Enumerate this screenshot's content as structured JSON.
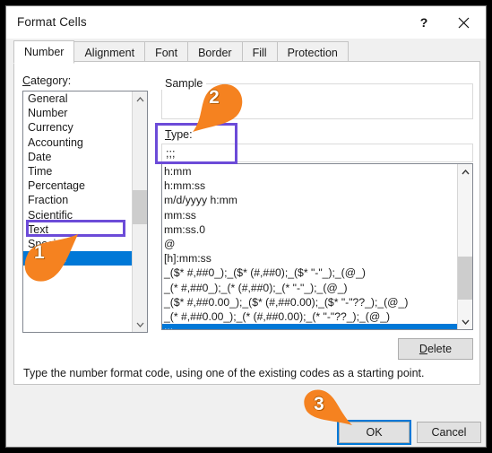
{
  "window": {
    "title": "Format Cells",
    "help_label": "?",
    "close_label": "✕"
  },
  "tabs": [
    {
      "label": "Number",
      "active": true
    },
    {
      "label": "Alignment",
      "active": false
    },
    {
      "label": "Font",
      "active": false
    },
    {
      "label": "Border",
      "active": false
    },
    {
      "label": "Fill",
      "active": false
    },
    {
      "label": "Protection",
      "active": false
    }
  ],
  "category": {
    "label": "Category:",
    "accelerator": "C",
    "items": [
      "General",
      "Number",
      "Currency",
      "Accounting",
      "Date",
      "Time",
      "Percentage",
      "Fraction",
      "Scientific",
      "Text",
      "Special",
      "Custom"
    ],
    "selected": "Custom",
    "selected_index": 11
  },
  "sample": {
    "legend": "Sample",
    "value": ""
  },
  "type": {
    "label": "Type:",
    "accelerator": "T",
    "value": ";;;",
    "placeholder": "",
    "items": [
      "h:mm",
      "h:mm:ss",
      "m/d/yyyy h:mm",
      "mm:ss",
      "mm:ss.0",
      "@",
      "[h]:mm:ss",
      "_($* #,##0_);_($* (#,##0);_($* \"-\"_);_(@_)",
      "_(* #,##0_);_(* (#,##0);_(* \"-\"_);_(@_)",
      "_($* #,##0.00_);_($* (#,##0.00);_($* \"-\"??_);_(@_)",
      "_(* #,##0.00_);_(* (#,##0.00);_(* \"-\"??_);_(@_)",
      ";;;"
    ],
    "selected": ";;;",
    "selected_index": 11
  },
  "buttons": {
    "delete": "Delete",
    "delete_accelerator": "D",
    "ok": "OK",
    "cancel": "Cancel"
  },
  "hint": "Type the number format code, using one of the existing codes as a starting point.",
  "annotations": {
    "callouts": [
      {
        "number": "1",
        "target": "custom-category-item"
      },
      {
        "number": "2",
        "target": "type-input-field"
      },
      {
        "number": "3",
        "target": "ok-button"
      }
    ],
    "highlight_boxes": [
      {
        "target": "custom-category-item"
      },
      {
        "target": "type-field-group"
      }
    ]
  },
  "colors": {
    "selection_blue": "#0078D7",
    "annotation_purple": "#6C4BD8",
    "callout_orange": "#F58220",
    "dialog_background": "#F0F0F0",
    "panel_background": "#FFFFFF"
  }
}
